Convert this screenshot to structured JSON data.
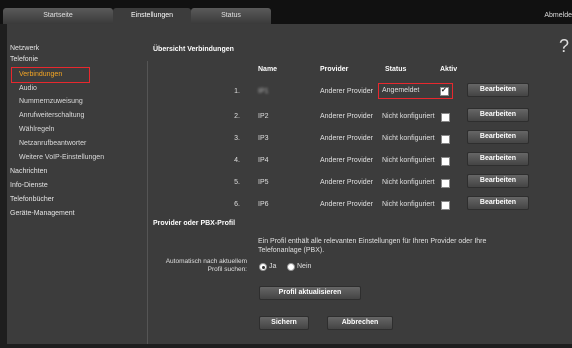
{
  "tabs": [
    {
      "label": "Startseite"
    },
    {
      "label": "Einstellungen"
    },
    {
      "label": "Status"
    }
  ],
  "logout_label": "Abmelde",
  "help_label": "?",
  "sidebar": {
    "items": [
      {
        "label": "Netzwerk"
      },
      {
        "label": "Telefonie"
      },
      {
        "label": "Verbindungen"
      },
      {
        "label": "Audio"
      },
      {
        "label": "Nummernzuweisung"
      },
      {
        "label": "Anrufweiterschaltung"
      },
      {
        "label": "Wählregeln"
      },
      {
        "label": "Netzanrufbeantworter"
      },
      {
        "label": "Weitere VoIP-Einstellungen"
      },
      {
        "label": "Nachrichten"
      },
      {
        "label": "Info-Dienste"
      },
      {
        "label": "Telefonbücher"
      },
      {
        "label": "Geräte-Management"
      }
    ]
  },
  "main": {
    "title": "Übersicht Verbindungen",
    "columns": {
      "name": "Name",
      "provider": "Provider",
      "status": "Status",
      "active": "Aktiv"
    },
    "rows": [
      {
        "num": "1.",
        "name": "IP1",
        "provider": "Anderer Provider",
        "status": "Angemeldet",
        "active": true,
        "edit": "Bearbeiten"
      },
      {
        "num": "2.",
        "name": "IP2",
        "provider": "Anderer Provider",
        "status": "Nicht konfiguriert",
        "active": false,
        "edit": "Bearbeiten"
      },
      {
        "num": "3.",
        "name": "IP3",
        "provider": "Anderer Provider",
        "status": "Nicht konfiguriert",
        "active": false,
        "edit": "Bearbeiten"
      },
      {
        "num": "4.",
        "name": "IP4",
        "provider": "Anderer Provider",
        "status": "Nicht konfiguriert",
        "active": false,
        "edit": "Bearbeiten"
      },
      {
        "num": "5.",
        "name": "IP5",
        "provider": "Anderer Provider",
        "status": "Nicht konfiguriert",
        "active": false,
        "edit": "Bearbeiten"
      },
      {
        "num": "6.",
        "name": "IP6",
        "provider": "Anderer Provider",
        "status": "Nicht konfiguriert",
        "active": false,
        "edit": "Bearbeiten"
      }
    ],
    "profile_heading": "Provider oder PBX-Profil",
    "profile_desc": "Ein Profil enthält alle relevanten Einstellungen für Ihren Provider oder Ihre Telefonanlage (PBX).",
    "auto_label_1": "Automatisch nach aktuellem",
    "auto_label_2": "Profil suchen:",
    "radio_yes": "Ja",
    "radio_no": "Nein",
    "update_button": "Profil aktualisieren",
    "save_button": "Sichern",
    "cancel_button": "Abbrechen"
  },
  "colors": {
    "accent": "#f5a623",
    "highlight": "#e8282e",
    "panel": "#3c3c3c"
  }
}
